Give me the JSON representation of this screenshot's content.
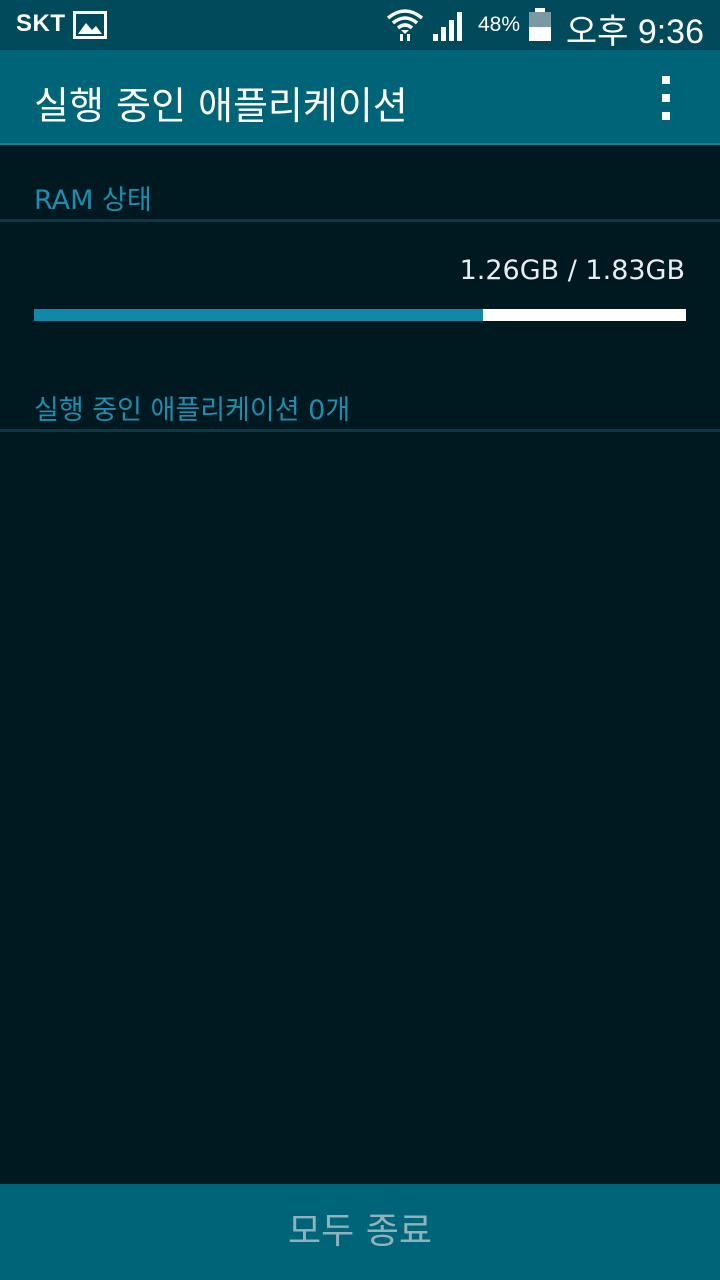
{
  "status_bar": {
    "carrier": "SKT",
    "battery_percent": "48%",
    "battery_level": 0.48,
    "time": "오후 9:36",
    "icons": [
      "gallery-icon",
      "wifi-icon",
      "signal-icon",
      "battery-icon"
    ]
  },
  "action_bar": {
    "title": "실행 중인 애플리케이션",
    "overflow_icon": "more-vert-icon"
  },
  "ram_section": {
    "header": "RAM 상태",
    "usage_text": "1.26GB / 1.83GB",
    "used_gb": 1.26,
    "total_gb": 1.83
  },
  "apps_section": {
    "header": "실행 중인 애플리케이션 0개"
  },
  "footer": {
    "end_all_label": "모두 종료"
  },
  "colors": {
    "status_bar_bg": "#004a5b",
    "action_bar_bg": "#006478",
    "background": "#001820",
    "accent": "#1a8fb0",
    "bar_fill": "#1188a8",
    "button_text": "#8fb2bb"
  }
}
